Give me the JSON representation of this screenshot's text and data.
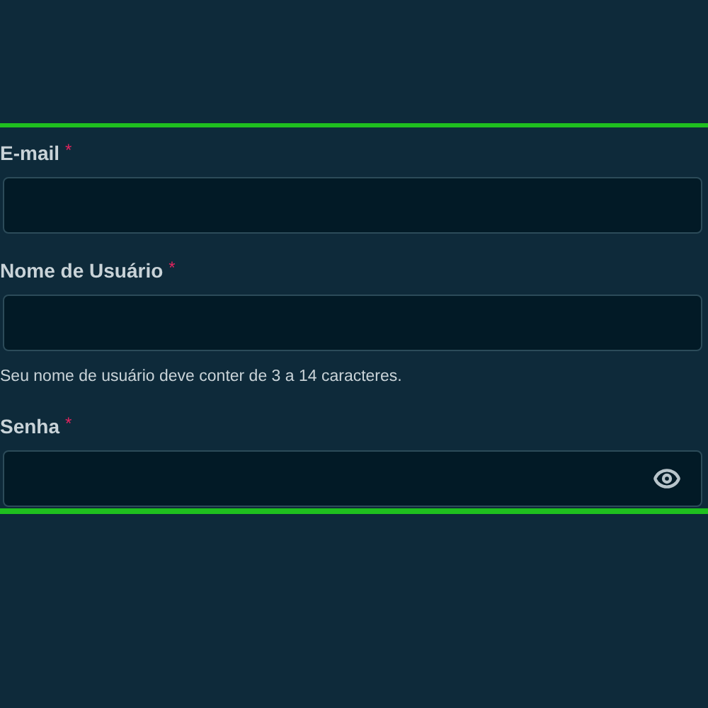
{
  "fields": [
    {
      "label": "E-mail",
      "required_mark": "*",
      "kind": "text"
    },
    {
      "label": "Nome de Usuário",
      "required_mark": "*",
      "kind": "text",
      "hint": "Seu nome de usuário deve conter de 3 a 14 caracteres."
    },
    {
      "label": "Senha",
      "required_mark": "*",
      "kind": "password"
    }
  ]
}
